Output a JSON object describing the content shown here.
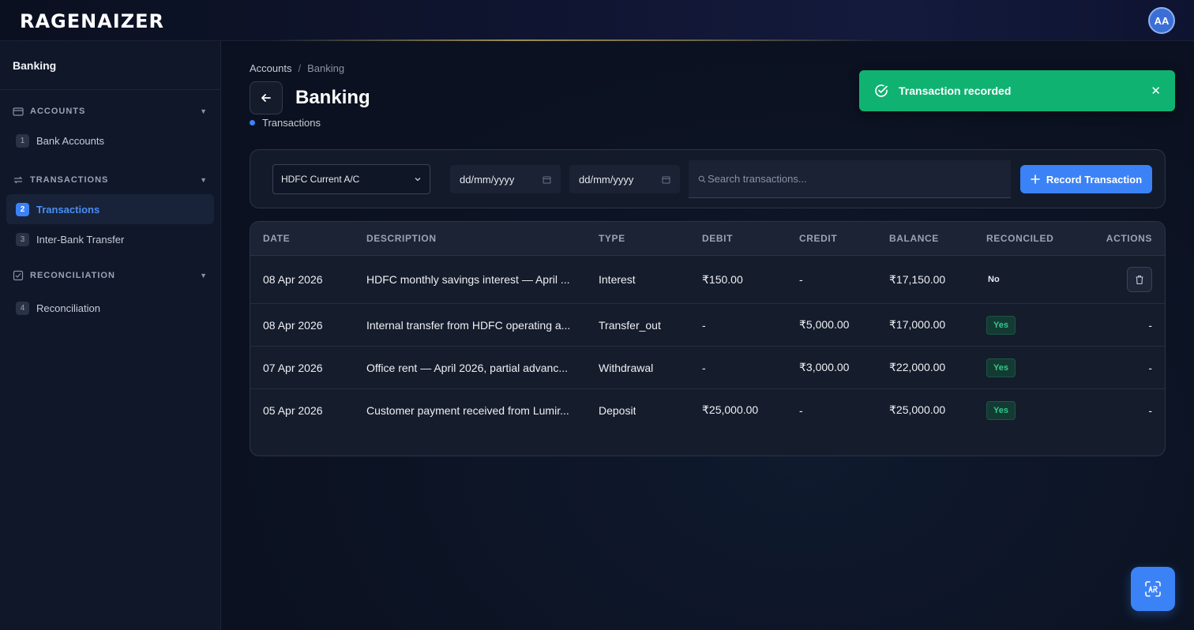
{
  "app": {
    "logo": "RAGENAIZER",
    "user_initials": "AA"
  },
  "sidebar": {
    "title": "Banking",
    "sections": [
      {
        "label": "ACCOUNTS",
        "items": [
          {
            "num": "1",
            "label": "Bank Accounts"
          }
        ]
      },
      {
        "label": "TRANSACTIONS",
        "items": [
          {
            "num": "2",
            "label": "Transactions"
          },
          {
            "num": "3",
            "label": "Inter-Bank Transfer"
          }
        ]
      },
      {
        "label": "RECONCILIATION",
        "items": [
          {
            "num": "4",
            "label": "Reconciliation"
          }
        ]
      }
    ]
  },
  "header": {
    "breadcrumb": [
      "Accounts",
      "Banking"
    ],
    "breadcrumb_sep": "/",
    "title": "Banking",
    "subtitle": "Transactions"
  },
  "filters": {
    "account": "HDFC Current A/C",
    "from_date": "dd/mm/yyyy",
    "to_date": "dd/mm/yyyy",
    "search_placeholder": "Search transactions...",
    "record_button": "Record Transaction"
  },
  "table": {
    "columns": [
      "DATE",
      "DESCRIPTION",
      "TYPE",
      "DEBIT",
      "CREDIT",
      "BALANCE",
      "RECONCILED",
      "ACTIONS"
    ],
    "rows": [
      {
        "date": "08 Apr 2026",
        "description": "HDFC monthly savings interest — April ...",
        "type": "Interest",
        "debit": "₹150.00",
        "credit": "-",
        "balance": "₹17,150.00",
        "reconciled": "No",
        "action": ""
      },
      {
        "date": "08 Apr 2026",
        "description": "Internal transfer from HDFC operating a...",
        "type": "Transfer_out",
        "debit": "-",
        "credit": "₹5,000.00",
        "balance": "₹17,000.00",
        "reconciled": "Yes",
        "action": "-"
      },
      {
        "date": "07 Apr 2026",
        "description": "Office rent — April 2026, partial advanc...",
        "type": "Withdrawal",
        "debit": "-",
        "credit": "₹3,000.00",
        "balance": "₹22,000.00",
        "reconciled": "Yes",
        "action": "-"
      },
      {
        "date": "05 Apr 2026",
        "description": "Customer payment received from Lumir...",
        "type": "Deposit",
        "debit": "₹25,000.00",
        "credit": "-",
        "balance": "₹25,000.00",
        "reconciled": "Yes",
        "action": "-"
      }
    ]
  },
  "toast": {
    "message": "Transaction recorded"
  },
  "colors": {
    "accent": "#3b82f6",
    "success": "#10b272",
    "background": "#0c1220"
  }
}
